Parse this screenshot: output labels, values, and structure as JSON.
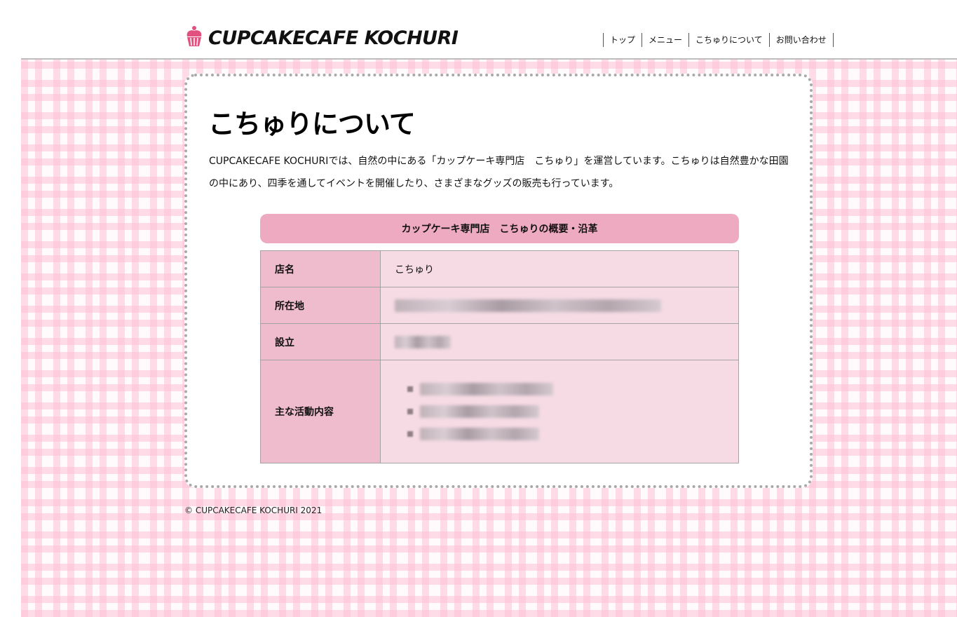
{
  "header": {
    "logo_text": "CUPCAKECAFE KOCHURI",
    "nav": [
      "トップ",
      "メニュー",
      "こちゅりについて",
      "お問い合わせ"
    ]
  },
  "main": {
    "title": "こちゅりについて",
    "intro": "CUPCAKECAFE KOCHURIでは、自然の中にある「カップケーキ専門店　こちゅり」を運営しています。こちゅりは自然豊かな田園の中にあり、四季を通してイベントを開催したり、さまざまなグッズの販売も行っています。",
    "table_heading": "カップケーキ専門店　こちゅりの概要・沿革",
    "rows": [
      {
        "label": "店名",
        "value": "こちゅり"
      },
      {
        "label": "所在地",
        "value": ""
      },
      {
        "label": "設立",
        "value": ""
      },
      {
        "label": "主な活動内容",
        "value": ""
      }
    ]
  },
  "footer": {
    "copyright": "© CUPCAKECAFE KOCHURI 2021"
  },
  "colors": {
    "accent_pink": "#eeaac0",
    "table_header_bg": "#eebccd",
    "table_cell_bg": "#f6dbe4",
    "logo_pink": "#e2507f"
  }
}
